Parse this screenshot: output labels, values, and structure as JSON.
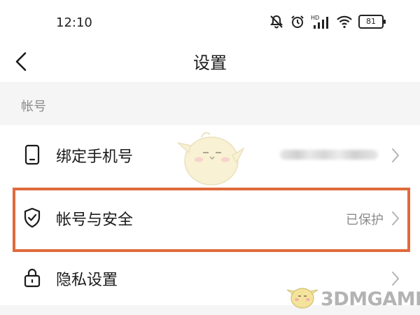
{
  "status_bar": {
    "time": "12:10",
    "battery": "81",
    "network_label": "HD",
    "icons": [
      "bell-muted-icon",
      "alarm-icon",
      "signal-icon",
      "wifi-icon",
      "battery-icon"
    ]
  },
  "nav": {
    "title": "设置",
    "back_icon": "chevron-left-icon"
  },
  "section": {
    "label": "帐号"
  },
  "rows": [
    {
      "label": "绑定手机号",
      "value": "",
      "icon": "phone-icon",
      "value_obscured": true
    },
    {
      "label": "帐号与安全",
      "value": "已保护",
      "icon": "shield-check-icon"
    },
    {
      "label": "隐私设置",
      "value": "",
      "icon": "lock-icon"
    }
  ],
  "watermark": {
    "text": "3DMGAME"
  },
  "colors": {
    "highlight": "#e06a3c",
    "section_bg": "#f5f5f5",
    "secondary_text": "#8c8c8c"
  }
}
